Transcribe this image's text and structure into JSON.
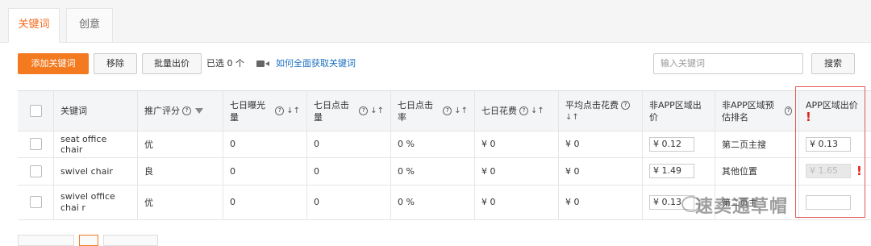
{
  "tabs": [
    {
      "label": "关键词"
    },
    {
      "label": "创意"
    }
  ],
  "toolbar": {
    "add_label": "添加关键词",
    "remove_label": "移除",
    "bulk_bid_label": "批量出价",
    "selected_text": "已选 0 个",
    "help_link": "如何全面获取关键词",
    "search_placeholder": "输入关键词",
    "search_label": "搜索"
  },
  "table": {
    "headers": [
      "关键词",
      "推广评分",
      "七日曝光量",
      "七日点击量",
      "七日点击率",
      "七日花费",
      "平均点击花费",
      "非APP区域出价",
      "非APP区域预估排名",
      "APP区域出价"
    ],
    "rows": [
      {
        "keyword": "seat office chair",
        "score": "优",
        "impressions": "0",
        "clicks": "0",
        "ctr": "0 %",
        "spend": "¥ 0",
        "avg_cpc": "¥ 0",
        "nonapp_bid": "¥ 0.12",
        "rank": "第二页主搜",
        "app_bid": "¥ 0.13"
      },
      {
        "keyword": "swivel chair",
        "score": "良",
        "impressions": "0",
        "clicks": "0",
        "ctr": "0 %",
        "spend": "¥ 0",
        "avg_cpc": "¥ 0",
        "nonapp_bid": "¥ 1.49",
        "rank": "其他位置",
        "app_bid": "¥ 1.65"
      },
      {
        "keyword": "swivel office chai r",
        "score": "优",
        "impressions": "0",
        "clicks": "0",
        "ctr": "0 %",
        "spend": "¥ 0",
        "avg_cpc": "¥ 0",
        "nonapp_bid": "¥ 0.13",
        "rank": "第二页主",
        "app_bid": ""
      }
    ]
  },
  "watermark": "速卖通草帽",
  "colors": {
    "accent": "#f47a20",
    "link": "#1a6fc1",
    "warning": "#e0221e"
  }
}
